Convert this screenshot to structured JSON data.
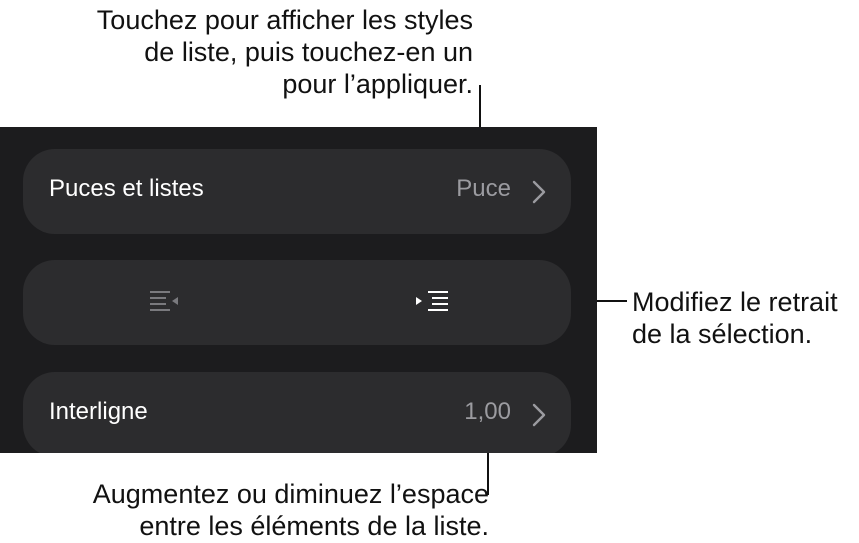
{
  "callouts": {
    "top": [
      "Touchez pour afficher les styles",
      "de liste, puis touchez-en un",
      "pour l’appliquer."
    ],
    "right": [
      "Modifiez le retrait",
      "de la sélection."
    ],
    "bottom": [
      "Augmentez ou diminuez l’espace",
      "entre les éléments de la liste."
    ]
  },
  "panel": {
    "bullets_row": {
      "label": "Puces et listes",
      "value": "Puce"
    },
    "indent_row": {
      "decrease_icon": "decrease-indent-icon",
      "increase_icon": "increase-indent-icon"
    },
    "spacing_row": {
      "label": "Interligne",
      "value": "1,00"
    }
  },
  "colors": {
    "panel_background": "#1c1c1e",
    "row_background": "#2c2c2e",
    "label_text": "#ffffff",
    "value_text": "#9b9ba0",
    "dimmed_icon": "#7a7a7e",
    "active_icon": "#ffffff"
  }
}
